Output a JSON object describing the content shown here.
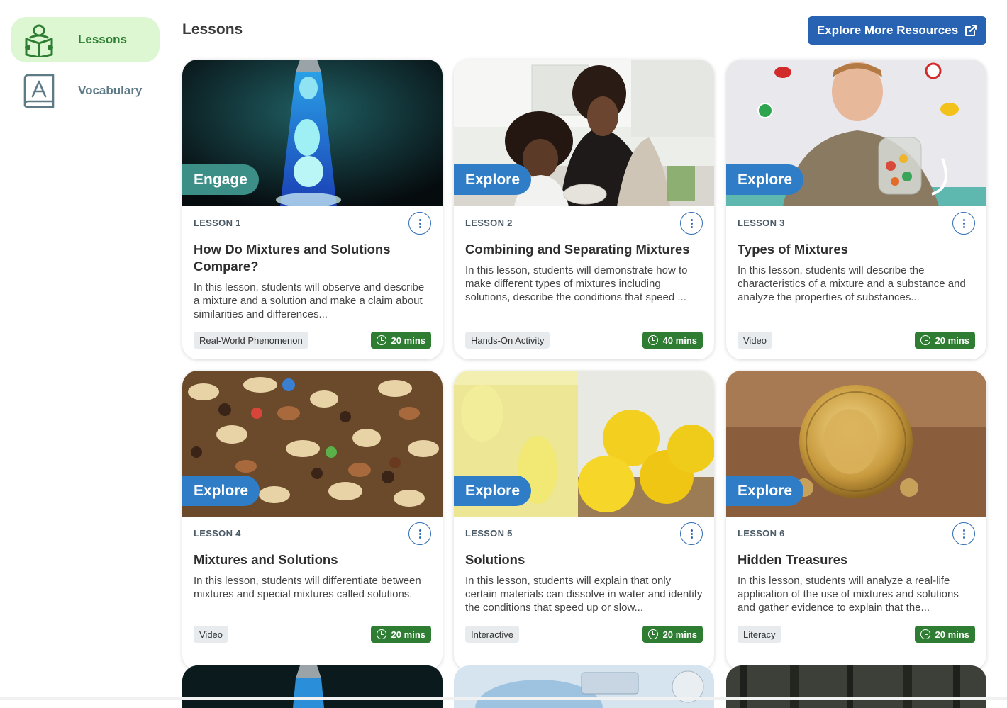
{
  "sidebar": {
    "items": [
      {
        "label": "Lessons",
        "icon": "book-reader-icon",
        "active": true
      },
      {
        "label": "Vocabulary",
        "icon": "vocabulary-book-icon",
        "active": false
      }
    ]
  },
  "header": {
    "title": "Lessons",
    "explore_button": "Explore More Resources"
  },
  "lessons": [
    {
      "number": "LESSON 1",
      "phase": "Engage",
      "title": "How Do Mixtures and Solutions Compare?",
      "description": "In this lesson, students will observe and describe a mixture and a solution and make a claim about similarities and differences...",
      "tag": "Real-World Phenomenon",
      "duration": "20 mins"
    },
    {
      "number": "LESSON 2",
      "phase": "Explore",
      "title": "Combining and Separating Mixtures",
      "description": "In this lesson, students will demonstrate how to make different types of mixtures including solutions, describe the conditions that speed ...",
      "tag": "Hands-On Activity",
      "duration": "40 mins"
    },
    {
      "number": "LESSON 3",
      "phase": "Explore",
      "title": "Types of Mixtures",
      "description": "In this lesson, students will describe the characteristics of a mixture and a substance and analyze the properties of substances...",
      "tag": "Video",
      "duration": "20 mins"
    },
    {
      "number": "LESSON 4",
      "phase": "Explore",
      "title": "Mixtures and Solutions",
      "description": "In this lesson, students will differentiate between mixtures and special mixtures called solutions.",
      "tag": "Video",
      "duration": "20 mins"
    },
    {
      "number": "LESSON 5",
      "phase": "Explore",
      "title": "Solutions",
      "description": "In this lesson, students will explain that only certain materials can dissolve in water and identify the conditions that speed up or slow...",
      "tag": "Interactive",
      "duration": "20 mins"
    },
    {
      "number": "LESSON 6",
      "phase": "Explore",
      "title": "Hidden Treasures",
      "description": "In this lesson, students will analyze a real-life application of the use of mixtures and solutions and gather evidence to explain that the...",
      "tag": "Literacy",
      "duration": "20 mins"
    }
  ],
  "colors": {
    "accent_blue": "#2863b3",
    "engage_teal": "#3c8f86",
    "explore_blue": "#2f7dc7",
    "duration_green": "#2e7d32",
    "active_nav_bg": "#dcf7d2"
  }
}
